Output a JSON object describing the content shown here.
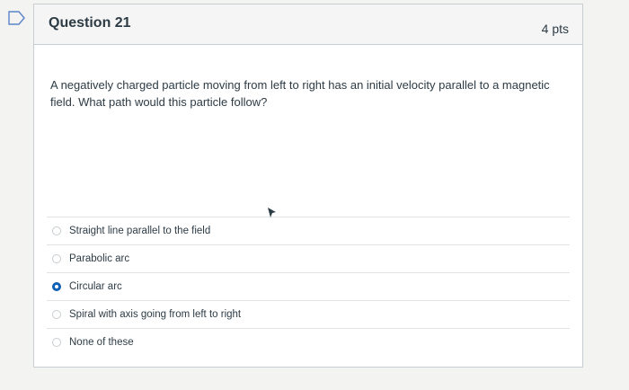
{
  "question": {
    "title": "Question 21",
    "points": "4 pts",
    "text": "A negatively charged particle moving from left to right has an initial velocity parallel to a magnetic field. What path would this particle follow?"
  },
  "answers": [
    {
      "label": "Straight line parallel to the field",
      "selected": false
    },
    {
      "label": "Parabolic arc",
      "selected": false
    },
    {
      "label": "Circular arc",
      "selected": true
    },
    {
      "label": "Spiral with axis going from left to right",
      "selected": false
    },
    {
      "label": "None of these",
      "selected": false
    }
  ],
  "colors": {
    "accent": "#0b5fb4",
    "text": "#2d3b45",
    "border": "#c7cdd1"
  }
}
